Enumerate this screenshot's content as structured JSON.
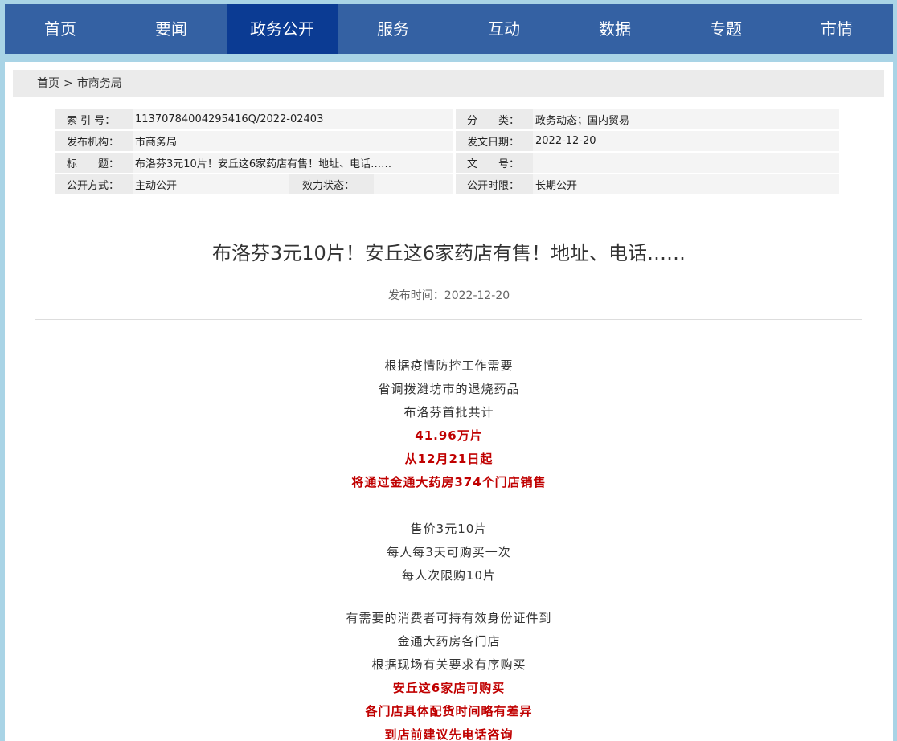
{
  "nav": {
    "items": [
      "首页",
      "要闻",
      "政务公开",
      "服务",
      "互动",
      "数据",
      "专题",
      "市情"
    ],
    "active_index": 2
  },
  "breadcrumb": {
    "home": "首页",
    "separator": ">",
    "current": "市商务局"
  },
  "meta": {
    "index_label": "索 引 号：",
    "index_value": "11370784004295416Q/2022-02403",
    "category_label": "分　　类：",
    "category_value": "政务动态；国内贸易",
    "publisher_label": "发布机构：",
    "publisher_value": "市商务局",
    "date_label": "发文日期：",
    "date_value": "2022-12-20",
    "title_label": "标　　题：",
    "title_value": "布洛芬3元10片！安丘这6家药店有售！地址、电话……",
    "docno_label": "文　　号：",
    "docno_value": "",
    "method_label": "公开方式：",
    "method_value": "主动公开",
    "status_label": "效力状态：",
    "status_value": "",
    "period_label": "公开时限：",
    "period_value": "长期公开"
  },
  "article": {
    "title": "布洛芬3元10片！安丘这6家药店有售！地址、电话……",
    "pubtime": "发布时间：2022-12-20",
    "lines": [
      {
        "text": "根据疫情防控工作需要",
        "style": "normal"
      },
      {
        "text": "省调拨潍坊市的退烧药品",
        "style": "normal"
      },
      {
        "text": "布洛芬首批共计",
        "style": "normal"
      },
      {
        "text": "41.96万片",
        "style": "red"
      },
      {
        "text": "从12月21日起",
        "style": "red"
      },
      {
        "text": "将通过金通大药房374个门店销售",
        "style": "red"
      },
      {
        "text": "",
        "style": "blank"
      },
      {
        "text": "售价3元10片",
        "style": "normal"
      },
      {
        "text": "每人每3天可购买一次",
        "style": "normal"
      },
      {
        "text": "每人次限购10片",
        "style": "normal"
      },
      {
        "text": "",
        "style": "blank-sm"
      },
      {
        "text": "有需要的消费者可持有效身份证件到",
        "style": "normal"
      },
      {
        "text": "金通大药房各门店",
        "style": "normal"
      },
      {
        "text": "根据现场有关要求有序购买",
        "style": "normal"
      },
      {
        "text": "安丘这6家店可购买",
        "style": "red"
      },
      {
        "text": "各门店具体配货时间略有差异",
        "style": "red"
      },
      {
        "text": "到店前建议先电话咨询",
        "style": "red"
      }
    ]
  }
}
